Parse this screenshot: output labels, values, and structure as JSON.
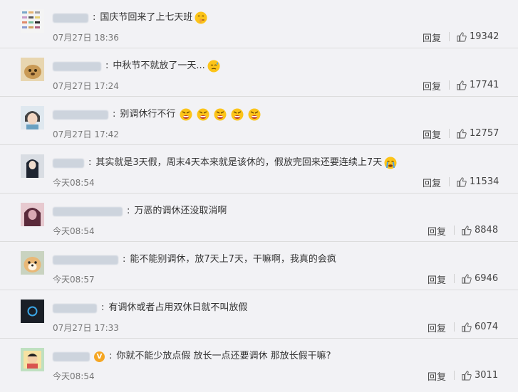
{
  "comments": [
    {
      "text": "国庆节回来了上七天班",
      "time": "07月27日 18:36",
      "reply": "回复",
      "likes": "19342",
      "emoji": [
        "shush-face-icon"
      ],
      "verified": false
    },
    {
      "text": "中秋节不就放了一天...",
      "time": "07月27日 17:24",
      "reply": "回复",
      "likes": "17741",
      "emoji": [
        "sweat-face-icon"
      ],
      "verified": false
    },
    {
      "text": "别调休行不行",
      "time": "07月27日 17:42",
      "reply": "回复",
      "likes": "12757",
      "emoji": [
        "angry-face-icon",
        "angry-face-icon",
        "angry-face-icon",
        "angry-face-icon",
        "angry-face-icon"
      ],
      "verified": false
    },
    {
      "text": "其实就是3天假，周末4天本来就是该休的，假放完回来还要连续上7天",
      "time": "今天08:54",
      "reply": "回复",
      "likes": "11534",
      "emoji": [
        "crying-face-icon"
      ],
      "verified": false
    },
    {
      "text": "万恶的调休还没取消啊",
      "time": "今天08:54",
      "reply": "回复",
      "likes": "8848",
      "emoji": [],
      "verified": false
    },
    {
      "text": "能不能别调休，放7天上7天，干嘛啊，我真的会疯",
      "time": "今天08:57",
      "reply": "回复",
      "likes": "6946",
      "emoji": [],
      "verified": false
    },
    {
      "text": "有调休或者占用双休日就不叫放假",
      "time": "07月27日 17:33",
      "reply": "回复",
      "likes": "6074",
      "emoji": [],
      "verified": false
    },
    {
      "text": "你就不能少放点假 放长一点还要调休 那放长假干嘛?",
      "time": "今天08:54",
      "reply": "回复",
      "likes": "3011",
      "emoji": [],
      "verified": true
    }
  ],
  "colors": {
    "background": "#f2f2f5",
    "text": "#333333",
    "meta": "#777777",
    "emoji_yellow": "#fcc419",
    "badge": "#f5a623"
  }
}
